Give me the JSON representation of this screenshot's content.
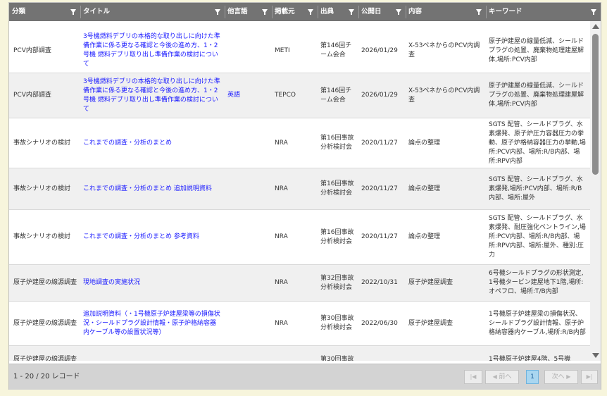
{
  "columns": [
    {
      "key": "category",
      "label": "分類"
    },
    {
      "key": "title",
      "label": "タイトル"
    },
    {
      "key": "lang",
      "label": "他言語"
    },
    {
      "key": "publisher",
      "label": "掲載元"
    },
    {
      "key": "source",
      "label": "出典"
    },
    {
      "key": "date",
      "label": "公開日"
    },
    {
      "key": "content",
      "label": "内容"
    },
    {
      "key": "keywords",
      "label": "キーワード"
    }
  ],
  "rows": [
    {
      "category": "PCV内部調査",
      "title": "3号機燃料デブリの本格的な取り出しに向けた準備作業に係る更なる確認と今後の進め方、1・2号機 燃料デブリ取り出し準備作業の検討について",
      "lang": "",
      "publisher": "METI",
      "source": "第146回チーム会合",
      "date": "2026/01/29",
      "content": "X-53ペネからのPCV内調査",
      "keywords": "原子炉建屋の線量低減、シールドプラグの処置、廃棄物処理建屋解体,場所:PCV内部"
    },
    {
      "category": "PCV内部調査",
      "title": "3号機燃料デブリの本格的な取り出しに向けた準備作業に係る更なる確認と今後の進め方、1・2号機 燃料デブリ取り出し準備作業の検討について",
      "lang": "英語",
      "publisher": "TEPCO",
      "source": "第146回チーム会合",
      "date": "2026/01/29",
      "content": "X-53ペネからのPCV内調査",
      "keywords": "原子炉建屋の線量低減、シールドプラグの処置、廃棄物処理建屋解体,場所:PCV内部"
    },
    {
      "category": "事故シナリオの検討",
      "title": "これまでの調査・分析のまとめ",
      "lang": "",
      "publisher": "NRA",
      "source": "第16回事故分析検討会",
      "date": "2020/11/27",
      "content": "論点の整理",
      "keywords": "SGTS 配管、シールドプラグ、水素爆発、原子炉圧力容器圧力の挙動、原子炉格納容器圧力の挙動,場所:PCV内部、場所:R/B内部、場所:RPV内部"
    },
    {
      "category": "事故シナリオの検討",
      "title": "これまでの調査・分析のまとめ 追加説明資料",
      "lang": "",
      "publisher": "NRA",
      "source": "第16回事故分析検討会",
      "date": "2020/11/27",
      "content": "論点の整理",
      "keywords": "SGTS 配管、シールドプラグ、水素爆発,場所:PCV内部、場所:R/B内部、場所:屋外"
    },
    {
      "category": "事故シナリオの検討",
      "title": "これまでの調査・分析のまとめ 参考資料",
      "lang": "",
      "publisher": "NRA",
      "source": "第16回事故分析検討会",
      "date": "2020/11/27",
      "content": "論点の整理",
      "keywords": "SGTS 配管、シールドプラグ、水素爆発、耐圧強化ベントライン,場所:PCV内部、場所:R/B内部、場所:RPV内部、場所:屋外、種別:圧力"
    },
    {
      "category": "原子炉建屋の線源調査",
      "title": "現地調査の実施状況",
      "lang": "",
      "publisher": "NRA",
      "source": "第32回事故分析検討会",
      "date": "2022/10/31",
      "content": "原子炉建屋調査",
      "keywords": "6号機シールドプラグの形状測定, 1号機タービン建屋地下1階,場所:オペフロ、場所:T/B内部"
    },
    {
      "category": "原子炉建屋の線源調査",
      "title": "追加説明資料（・1号機原子炉建屋梁等の損傷状況・シールドプラグ設計情報・原子炉格納容器内ケーブル等の設置状況等）",
      "lang": "",
      "publisher": "NRA",
      "source": "第30回事故分析検討会",
      "date": "2022/06/30",
      "content": "原子炉建屋調査",
      "keywords": "1号機原子炉建屋梁の損傷状況、シールドプラグ設計情報、原子炉格納容器内ケーブル,場所:R/B内部"
    },
    {
      "category": "原子炉建屋の線源調査",
      "title": "",
      "lang": "",
      "publisher": "",
      "source": "第30回事故",
      "date": "",
      "content": "",
      "keywords": "1号機原子炉建屋4階、5号機"
    }
  ],
  "pager": {
    "record_count": "1 - 20 / 20 レコード",
    "first_icon": "first-page-icon",
    "prev_label": "前へ",
    "current_page": "1",
    "next_label": "次へ",
    "last_icon": "last-page-icon"
  }
}
